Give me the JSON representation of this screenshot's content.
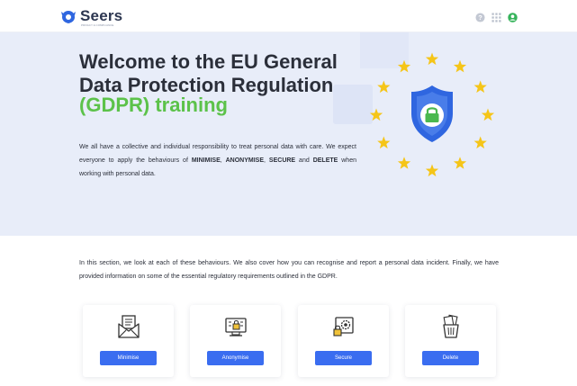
{
  "header": {
    "logo_text": "Seers",
    "logo_subtext": "PRIVACY & COMPLIANCE",
    "icons": [
      "help-icon",
      "apps-grid-icon",
      "user-account-icon"
    ]
  },
  "hero": {
    "title_line": "Welcome to the EU General Data Protection Regulation",
    "title_highlight": "(GDPR) training",
    "intro_part1": "We all have a collective and individual responsibility to treat personal data with care. We expect everyone to apply the behaviours of ",
    "minimise": "MINIMISE",
    "comma1": ", ",
    "anonymise": "ANONYMISE",
    "comma2": ", ",
    "secure": "SECURE",
    "and": " and ",
    "delete": "DELETE",
    "intro_part2": " when working with personal data."
  },
  "section": {
    "text": "In this section, we look at each of these behaviours. We also cover how you can recognise and report a personal data incident. Finally, we have provided information on some of the essential regulatory requirements outlined in the GDPR."
  },
  "cards": [
    {
      "icon": "envelope-document-icon",
      "button": "Minimise"
    },
    {
      "icon": "monitor-lock-icon",
      "button": "Anonymise"
    },
    {
      "icon": "gear-lock-icon",
      "button": "Secure"
    },
    {
      "icon": "trash-documents-icon",
      "button": "Delete"
    }
  ],
  "colors": {
    "accent_blue": "#3a6df0",
    "highlight_green": "#5cc24a",
    "hero_background": "#e8edf9",
    "star_yellow": "#f5c518",
    "shield_blue": "#2f66e0"
  }
}
